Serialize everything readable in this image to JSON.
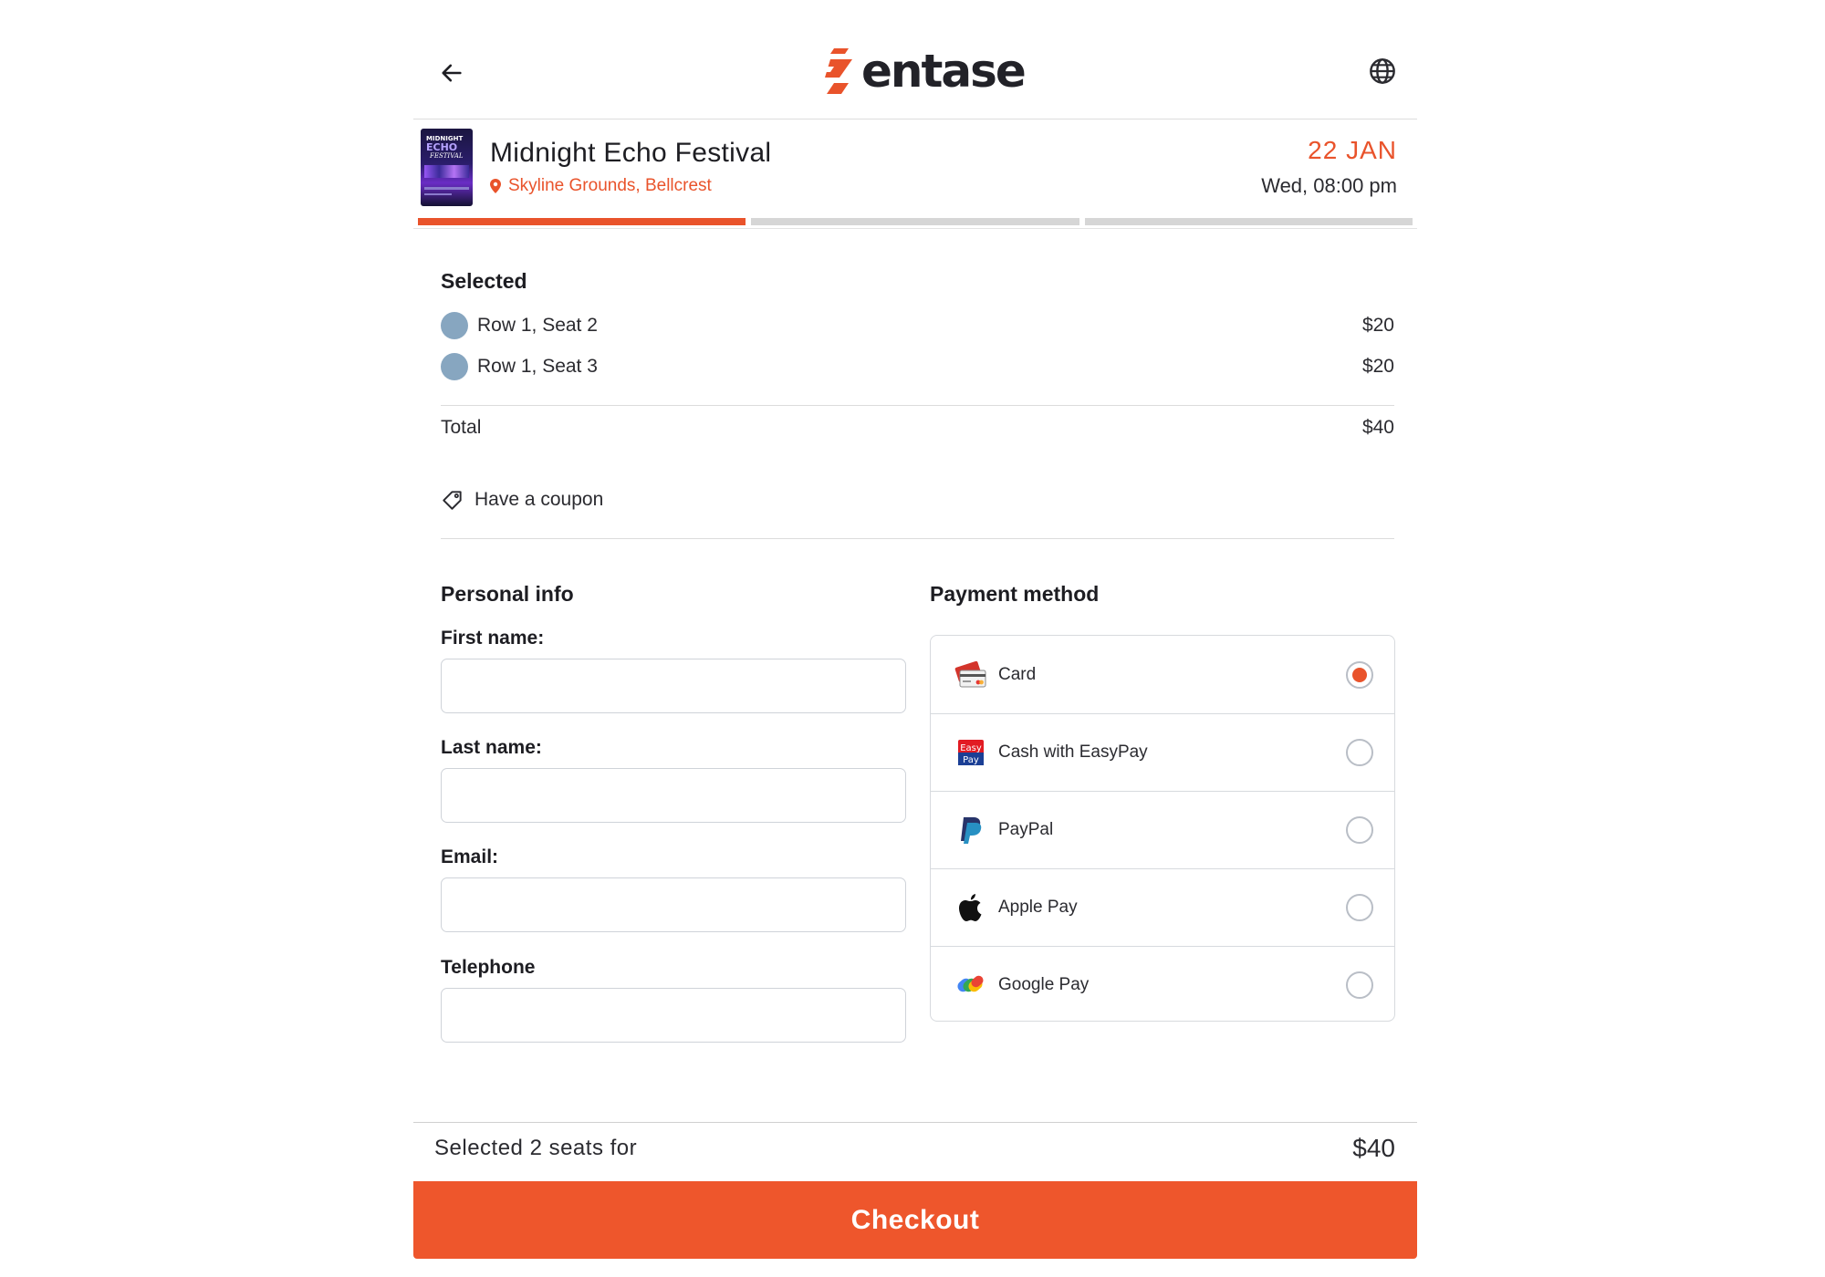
{
  "header": {
    "back_icon": "arrow-left-icon",
    "logo_text": "entase",
    "language_icon": "globe-icon"
  },
  "event": {
    "poster_text": [
      "MIDNIGHT",
      "ECHO",
      "FESTIVAL"
    ],
    "title": "Midnight Echo Festival",
    "venue": "Skyline Grounds, Bellcrest",
    "date": "22 JAN",
    "time": "Wed, 08:00 pm"
  },
  "progress": {
    "steps": 3,
    "current_step": 1
  },
  "selected": {
    "title": "Selected",
    "seats": [
      {
        "label": "Row 1, Seat 2",
        "price": "$20"
      },
      {
        "label": "Row 1, Seat 3",
        "price": "$20"
      }
    ],
    "total_label": "Total",
    "total_value": "$40",
    "coupon_label": "Have a coupon"
  },
  "personal": {
    "title": "Personal info",
    "first_name_label": "First name:",
    "last_name_label": "Last name:",
    "email_label": "Email:",
    "telephone_label": "Telephone",
    "first_name_value": "",
    "last_name_value": "",
    "email_value": "",
    "telephone_value": ""
  },
  "payment": {
    "title": "Payment method",
    "methods": [
      {
        "label": "Card",
        "icon": "credit-card-icon",
        "selected": true
      },
      {
        "label": "Cash with EasyPay",
        "icon": "easypay-icon",
        "selected": false
      },
      {
        "label": "PayPal",
        "icon": "paypal-icon",
        "selected": false
      },
      {
        "label": "Apple Pay",
        "icon": "apple-icon",
        "selected": false
      },
      {
        "label": "Google Pay",
        "icon": "google-pay-icon",
        "selected": false
      }
    ],
    "easypay_icon_text": [
      "Easy",
      "Pay"
    ]
  },
  "footer": {
    "summary": "Selected 2 seats for",
    "price": "$40",
    "checkout_label": "Checkout"
  },
  "colors": {
    "accent": "#e9532b",
    "seat_dot": "#87a6c0",
    "progress_inactive": "#d6d6d6"
  }
}
